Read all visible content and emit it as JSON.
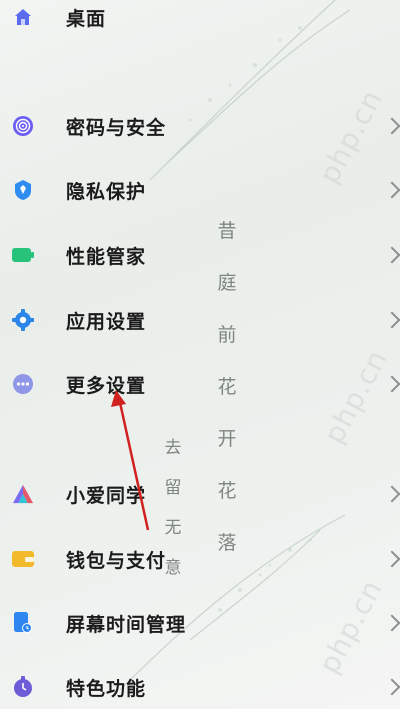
{
  "settings_menu": [
    {
      "label": "桌面",
      "icon": "home-icon",
      "color": "#5b6bf0"
    },
    {
      "label": "密码与安全",
      "icon": "fingerprint-icon",
      "color": "#6b5ef5"
    },
    {
      "label": "隐私保护",
      "icon": "privacy-shield-icon",
      "color": "#2f8cf0"
    },
    {
      "label": "性能管家",
      "icon": "battery-icon",
      "color": "#27c37a"
    },
    {
      "label": "应用设置",
      "icon": "gear-icon",
      "color": "#2a86e8"
    },
    {
      "label": "更多设置",
      "icon": "more-dots-icon",
      "color": "#8f96e8"
    },
    {
      "label": "小爱同学",
      "icon": "xiaoai-icon",
      "color": "#e25b6a"
    },
    {
      "label": "钱包与支付",
      "icon": "wallet-icon",
      "color": "#f2b92b"
    },
    {
      "label": "屏幕时间管理",
      "icon": "screen-time-icon",
      "color": "#2f86f0"
    },
    {
      "label": "特色功能",
      "icon": "features-icon",
      "color": "#6e5bd8"
    }
  ],
  "wallpaper_text": {
    "column_a": [
      "昔",
      "庭",
      "前",
      "花",
      "开",
      "花",
      "落"
    ],
    "column_b": [
      "去",
      "留",
      "无",
      "意"
    ]
  },
  "watermark": "php.cn",
  "annotation": {
    "arrow_color": "#d12020",
    "arrow_target": "更多设置"
  }
}
